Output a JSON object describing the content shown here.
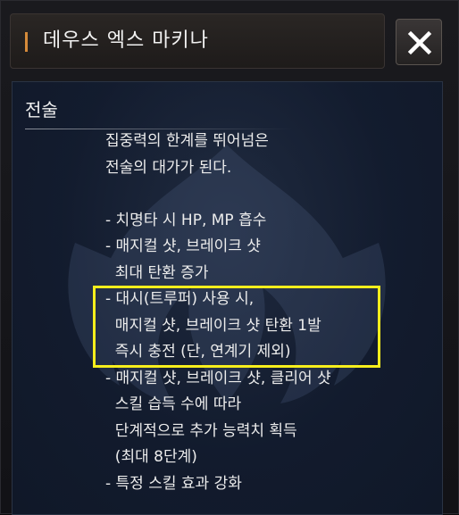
{
  "window": {
    "title": "데우스 엑스 마키나",
    "accent_color": "#d58a3a",
    "close_icon": "close-icon"
  },
  "section": {
    "title": "전술"
  },
  "description": {
    "lines": [
      "집중력의 한계를 뛰어넘은",
      "전술의 대가가 된다.",
      "",
      "- 치명타 시 HP, MP 흡수",
      "- 매지컬 샷, 브레이크 샷",
      "  최대 탄환 증가",
      "- 대시(트루퍼) 사용 시,",
      "  매지컬 샷, 브레이크 샷 탄환 1발",
      "  즉시 충전 (단, 연계기 제외)",
      "- 매지컬 샷, 브레이크 샷, 클리어 샷",
      "  스킬 습득 수에 따라",
      "  단계적으로 추가 능력치 획득",
      "  (최대 8단계)",
      "- 특정 스킬 효과 강화"
    ]
  },
  "highlight": {
    "color": "#f6ee1c"
  }
}
